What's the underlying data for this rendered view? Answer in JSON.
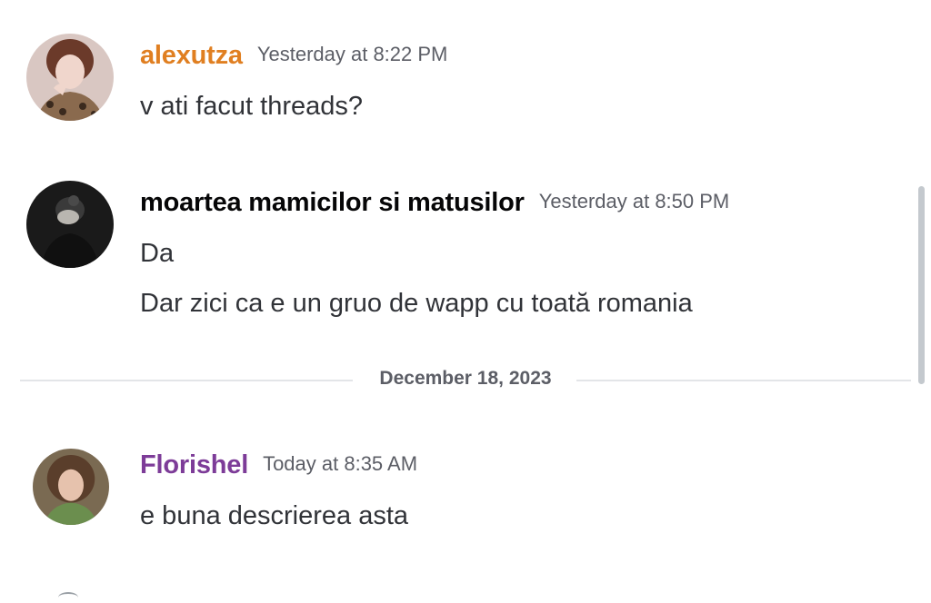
{
  "messages": [
    {
      "author": "alexutza",
      "timestamp": "Yesterday at 8:22 PM",
      "lines": [
        "v ati facut threads?"
      ],
      "author_color": "#e07f21"
    },
    {
      "author": "moartea mamicilor si matusilor",
      "timestamp": "Yesterday at 8:50 PM",
      "lines": [
        "Da",
        "Dar zici ca e un gruo de wapp cu toată romania"
      ],
      "author_color": "#060607"
    },
    {
      "author": "Florishel",
      "timestamp": "Today at 8:35 AM",
      "lines": [
        "e buna descrierea asta"
      ],
      "author_color": "#7d3c98"
    }
  ],
  "date_divider": "December 18, 2023"
}
